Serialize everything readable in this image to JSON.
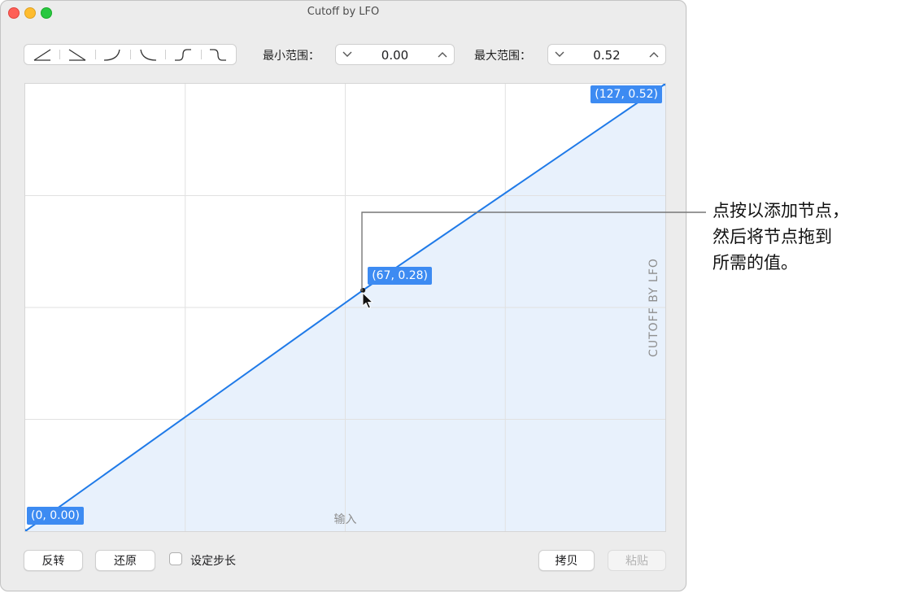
{
  "window": {
    "title": "Cutoff by LFO"
  },
  "toolbar": {
    "shape_buttons": [
      "linear-up",
      "linear-down",
      "curve-convex",
      "curve-concave",
      "s-curve",
      "s-curve-inverse"
    ],
    "min_range_label": "最小范围：",
    "min_range_value": "0.00",
    "max_range_label": "最大范围：",
    "max_range_value": "0.52"
  },
  "graph": {
    "x_axis_label": "输入",
    "y_axis_label": "CUTOFF BY LFO",
    "line_color": "#1f7ae8",
    "fill_color": "#e6f0fc",
    "badge_color": "#3d8bf2",
    "x_range": [
      0,
      127
    ],
    "y_range": [
      0,
      0.52
    ],
    "nodes": [
      {
        "x": 0,
        "y": 0.0,
        "label": "(0, 0.00)"
      },
      {
        "x": 67,
        "y": 0.28,
        "label": "(67, 0.28)"
      },
      {
        "x": 127,
        "y": 0.52,
        "label": "(127, 0.52)"
      }
    ]
  },
  "bottom": {
    "invert_label": "反转",
    "reset_label": "还原",
    "set_step_label": "设定步长",
    "set_step_checked": false,
    "copy_label": "拷贝",
    "paste_label": "粘贴"
  },
  "callout": {
    "lines": [
      "点按以添加节点，",
      "然后将节点拖到",
      "所需的值。"
    ]
  }
}
